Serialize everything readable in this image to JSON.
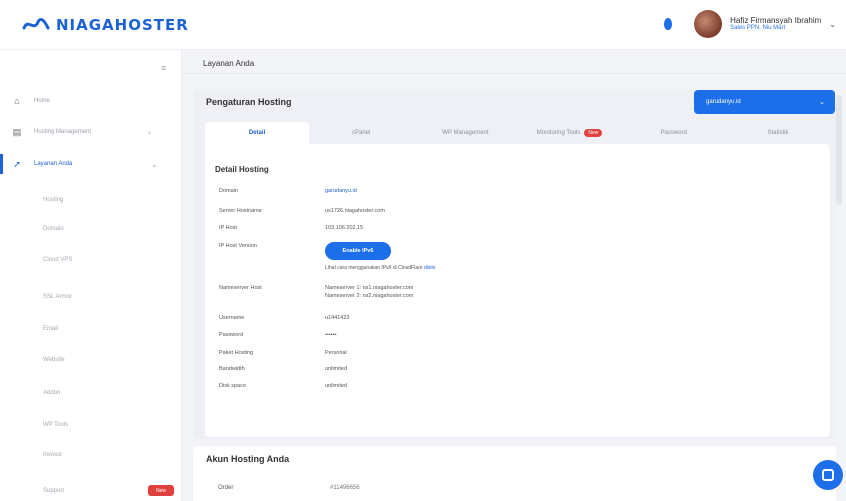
{
  "brand": {
    "name": "NIAGAHOSTER"
  },
  "header": {
    "user_name": "Hafiz Firmansyah Ibrahim",
    "user_sub": "Sales PPN, Niu Mart"
  },
  "sidebar": {
    "items": [
      {
        "label": "Home",
        "icon": "home-icon",
        "glyph": "⌂"
      },
      {
        "label": "Hosting Management",
        "icon": "document-icon",
        "glyph": "▤"
      },
      {
        "label": "Layanan Anda",
        "icon": "rocket-icon",
        "glyph": "➚"
      }
    ],
    "sub_items": [
      "Hosting",
      "Domain",
      "Cloud VPS",
      "SSL Armor",
      "Email",
      "Website",
      "Addon",
      "WP Tools",
      "Invoice",
      "Support"
    ],
    "new_badge": "New"
  },
  "breadcrumb": "Layanan Anda",
  "hosting": {
    "title": "Pengaturan Hosting",
    "domain_selected": "garudanyu.id",
    "tabs": [
      "Detail",
      "cPanel",
      "WP Management",
      "Monitoring Tools",
      "Password",
      "Statistik"
    ],
    "hot_badge": "New",
    "detail_title": "Detail Hosting",
    "rows": [
      {
        "label": "Domain",
        "value": "garudanyu.id",
        "link": true
      },
      {
        "label": "Server Hostname",
        "value": "us1726.niagahoster.com",
        "link": false
      },
      {
        "label": "IP Host",
        "value": "103.106.202.15",
        "link": false
      },
      {
        "label": "IP Host Version",
        "value": "",
        "link": false
      },
      {
        "label": "Nameserver Host",
        "value": "Nameserver 1: ns1.niagahoster.com",
        "value2": "Nameserver 2: ns2.niagahoster.com",
        "link": false
      },
      {
        "label": "Username",
        "value": "u1441423",
        "link": false
      },
      {
        "label": "Password",
        "value": "••••••",
        "link": false
      },
      {
        "label": "Paket Hosting",
        "value": "Personal",
        "link": false
      },
      {
        "label": "Bandwidth",
        "value": "unlimited",
        "link": false
      },
      {
        "label": "Disk space",
        "value": "unlimited",
        "link": false
      }
    ],
    "ipv6_button": "Enable IPv6",
    "ipv6_note": "Lihat cara menggunakan IPv6 di CloudFlare",
    "ipv6_note_link": "disini"
  },
  "akun": {
    "title": "Akun Hosting Anda",
    "order_label": "Order",
    "order_value": "#11496656"
  },
  "colors": {
    "accent": "#1c6fe8",
    "danger": "#e0413e"
  }
}
